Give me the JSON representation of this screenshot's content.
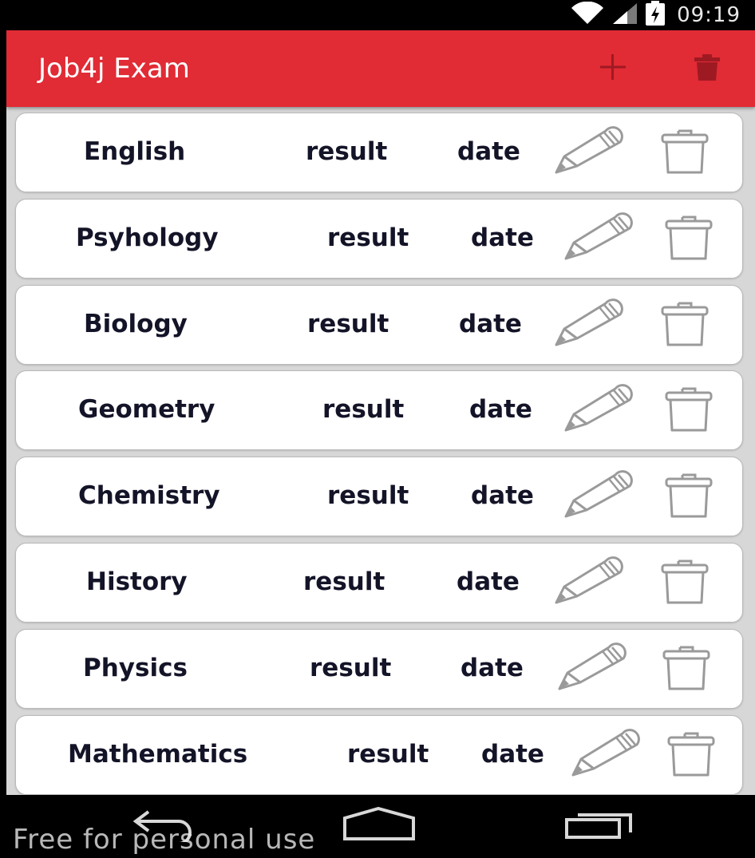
{
  "status_bar": {
    "time": "09:19",
    "icons": [
      "wifi-icon",
      "signal-icon",
      "battery-charging-icon"
    ]
  },
  "app_bar": {
    "title": "Job4j Exam",
    "accent_color": "#e12b35",
    "actions": [
      {
        "name": "add",
        "icon": "plus-icon"
      },
      {
        "name": "delete-all",
        "icon": "trash-icon"
      }
    ]
  },
  "exams": [
    {
      "name": "English",
      "result": "result",
      "date": "date"
    },
    {
      "name": "Psyhology",
      "result": "result",
      "date": "date"
    },
    {
      "name": "Biology",
      "result": "result",
      "date": "date"
    },
    {
      "name": "Geometry",
      "result": "result",
      "date": "date"
    },
    {
      "name": "Chemistry",
      "result": "result",
      "date": "date"
    },
    {
      "name": "History",
      "result": "result",
      "date": "date"
    },
    {
      "name": "Physics",
      "result": "result",
      "date": "date"
    },
    {
      "name": "Mathematics",
      "result": "result",
      "date": "date"
    }
  ],
  "row_icons": {
    "edit": "pencil-icon",
    "delete": "trash-icon"
  },
  "nav_bar": {
    "icons": [
      "back-icon",
      "home-icon",
      "recent-apps-icon"
    ]
  },
  "watermark": "Free for personal use"
}
